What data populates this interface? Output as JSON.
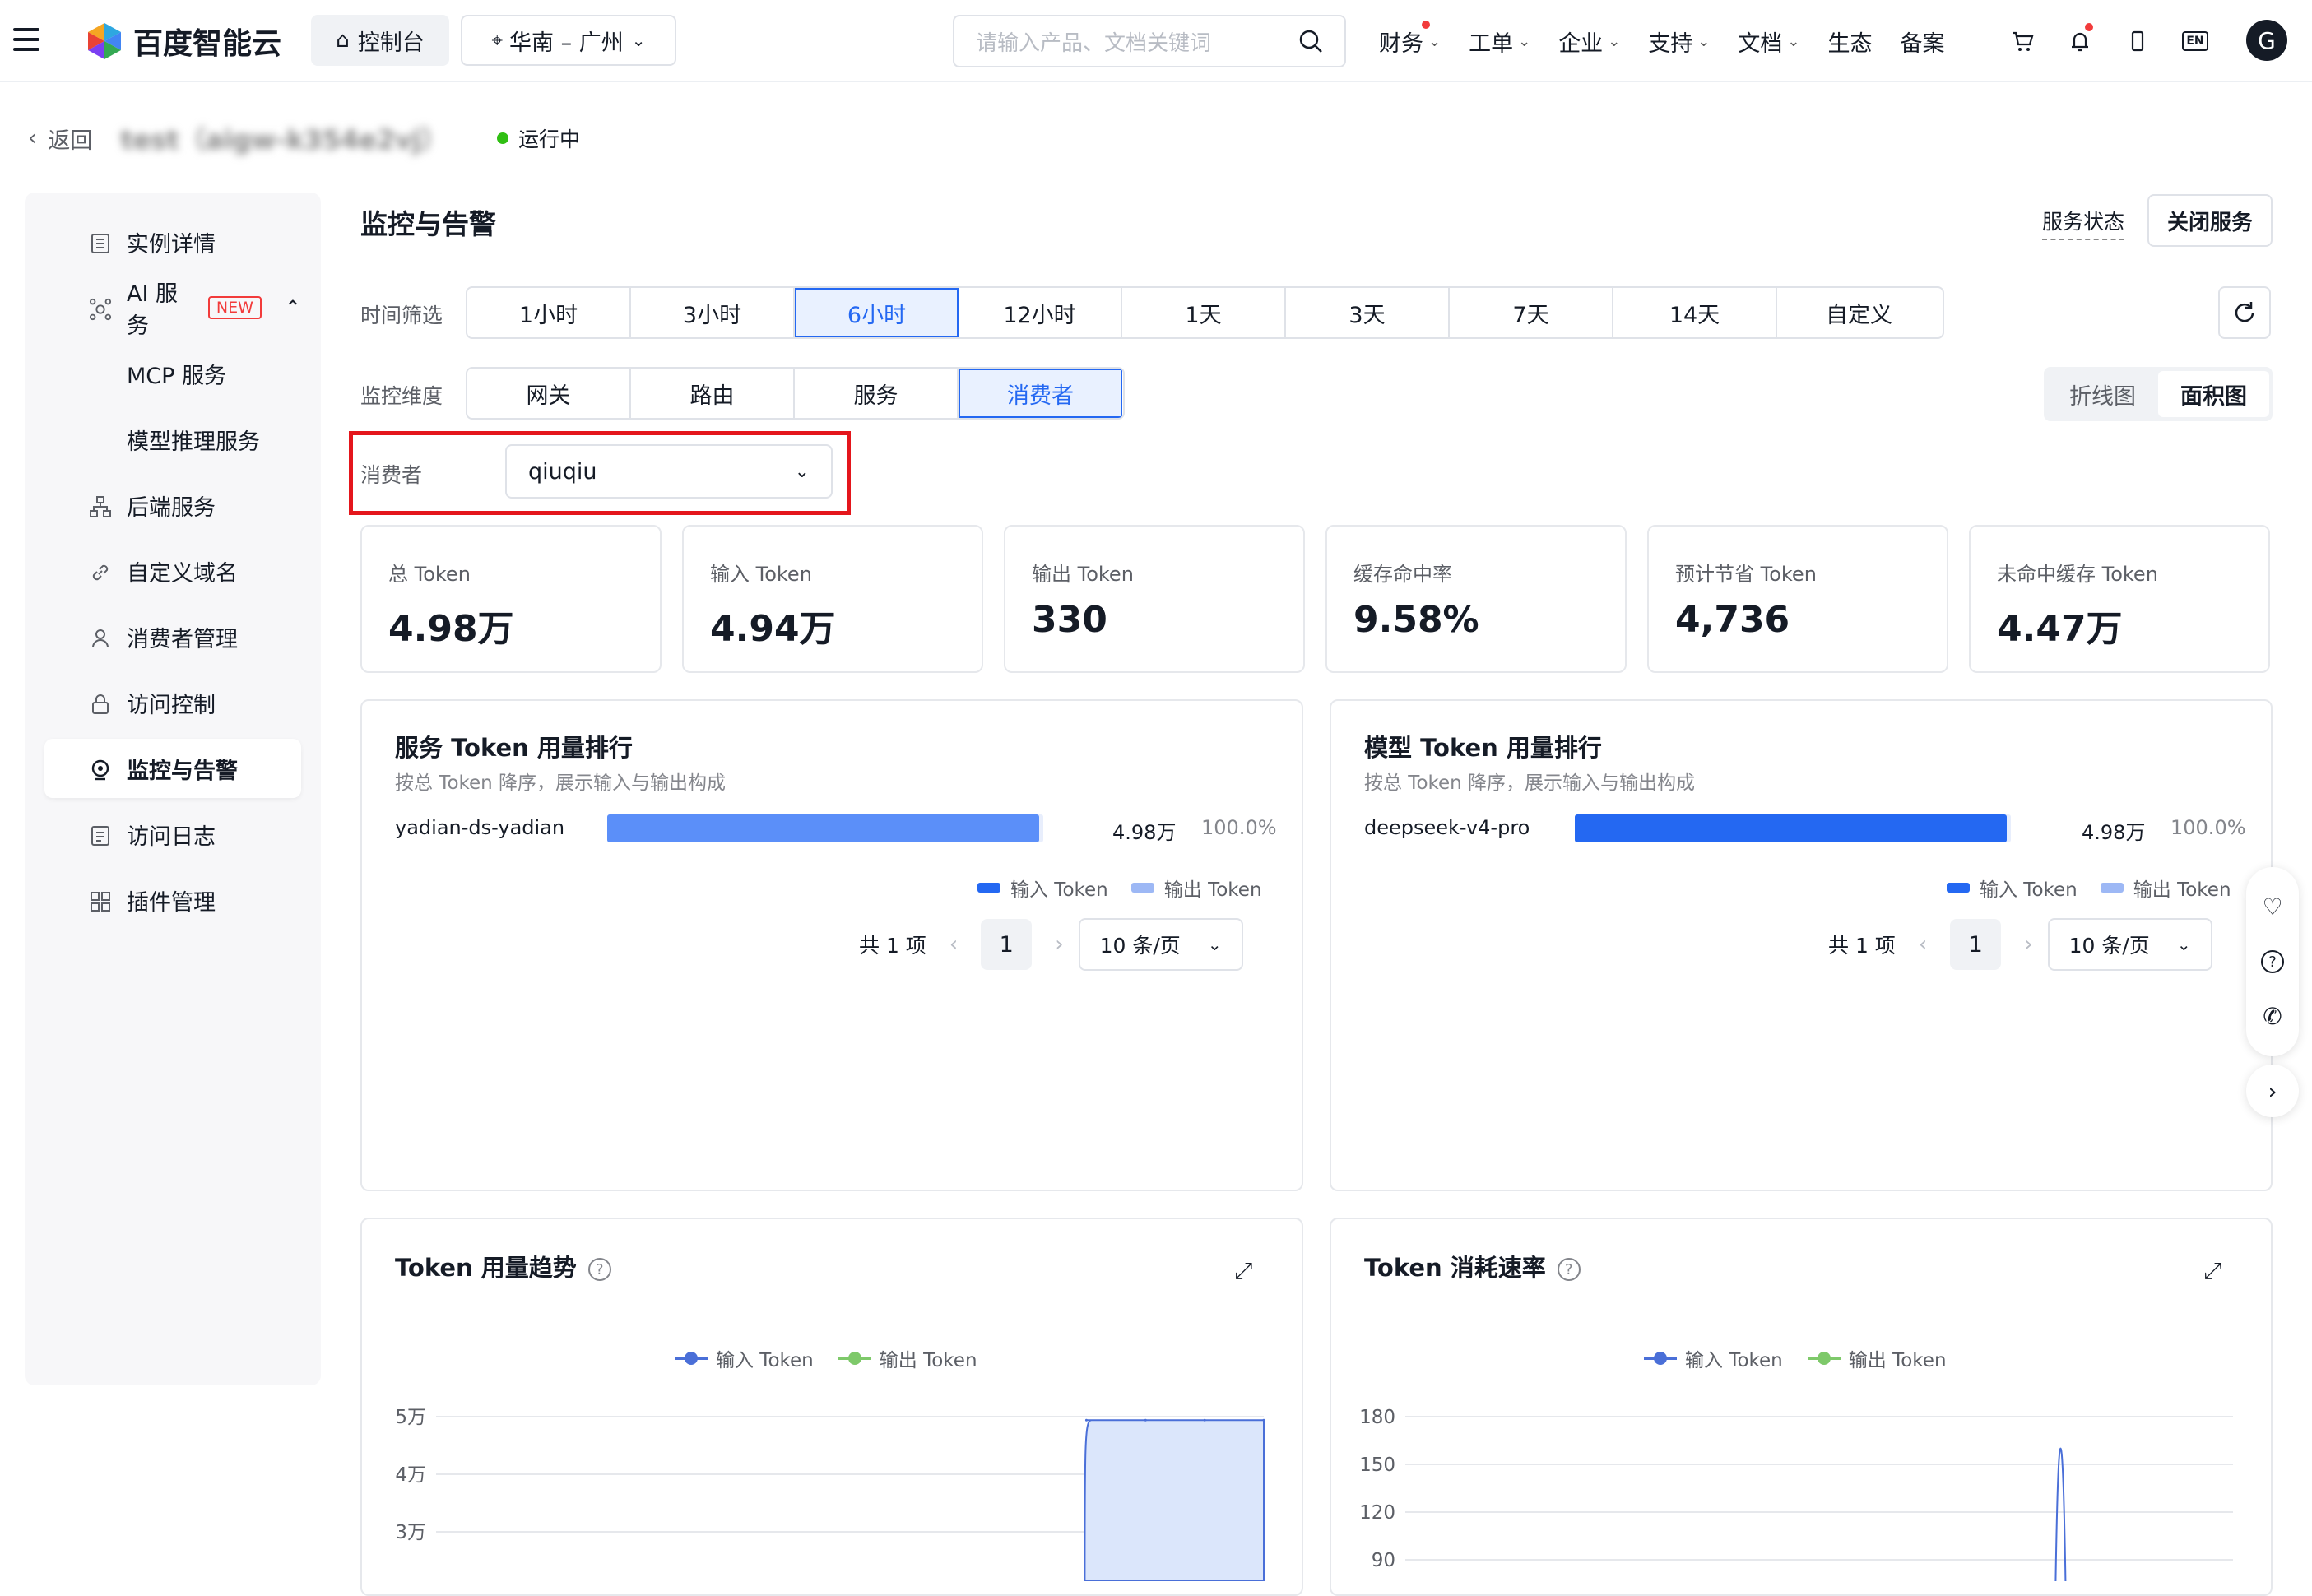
{
  "topbar": {
    "logo_text": "百度智能云",
    "console_label": "控制台",
    "region_label": "华南 – 广州",
    "search_placeholder": "请输入产品、文档关键词",
    "nav": [
      {
        "label": "财务",
        "dot": true
      },
      {
        "label": "工单"
      },
      {
        "label": "企业"
      },
      {
        "label": "支持"
      },
      {
        "label": "文档"
      },
      {
        "label": "生态"
      },
      {
        "label": "备案"
      }
    ],
    "avatar_letter": "G",
    "en_label": "EN"
  },
  "header": {
    "back_label": "返回",
    "instance_title": "test（aigw-k354e2vj）",
    "status_label": "运行中",
    "status_color": "#30bf13"
  },
  "sidebar": {
    "items": [
      {
        "label": "实例详情",
        "icon": "doc-list-icon"
      },
      {
        "label": "AI 服务",
        "icon": "ai-network-icon",
        "badge": "NEW"
      },
      {
        "label": "MCP 服务"
      },
      {
        "label": "模型推理服务"
      },
      {
        "label": "后端服务",
        "icon": "hierarchy-icon"
      },
      {
        "label": "自定义域名",
        "icon": "link-icon"
      },
      {
        "label": "消费者管理",
        "icon": "user-icon"
      },
      {
        "label": "访问控制",
        "icon": "lock-icon"
      },
      {
        "label": "监控与告警",
        "icon": "monitor-icon",
        "active": true
      },
      {
        "label": "访问日志",
        "icon": "log-icon"
      },
      {
        "label": "插件管理",
        "icon": "grid-icon"
      }
    ]
  },
  "main": {
    "title": "监控与告警",
    "service_status_label": "服务状态",
    "close_service_label": "关闭服务",
    "time_filter_label": "时间筛选",
    "time_options": [
      "1小时",
      "3小时",
      "6小时",
      "12小时",
      "1天",
      "3天",
      "7天",
      "14天",
      "自定义"
    ],
    "time_selected": "6小时",
    "dimension_label": "监控维度",
    "dimension_options": [
      "网关",
      "路由",
      "服务",
      "消费者"
    ],
    "dimension_selected": "消费者",
    "chart_types": [
      "折线图",
      "面积图"
    ],
    "chart_type_selected": "面积图",
    "consumer_label": "消费者",
    "consumer_value": "qiuqiu",
    "highlight_color": "#e4161c",
    "accent_color": "#2468f2"
  },
  "stats": [
    {
      "label": "总 Token",
      "value": "4.98万"
    },
    {
      "label": "输入 Token",
      "value": "4.94万"
    },
    {
      "label": "输出 Token",
      "value": "330"
    },
    {
      "label": "缓存命中率",
      "value": "9.58%"
    },
    {
      "label": "预计节省 Token",
      "value": "4,736"
    },
    {
      "label": "未命中缓存 Token",
      "value": "4.47万"
    }
  ],
  "rank_cards": [
    {
      "title": "服务 Token 用量排行",
      "subtitle": "按总 Token 降序，展示输入与输出构成",
      "rows": [
        {
          "name": "yadian-ds-yadian",
          "value": "4.98万",
          "pct": "100.0%",
          "input_share": 0.99
        }
      ],
      "bar_color": "#5b8ff9",
      "legend": [
        "输入 Token",
        "输出 Token"
      ],
      "total_label": "共 1 项",
      "page": "1",
      "page_size": "10 条/页"
    },
    {
      "title": "模型 Token 用量排行",
      "subtitle": "按总 Token 降序，展示输入与输出构成",
      "rows": [
        {
          "name": "deepseek-v4-pro",
          "value": "4.98万",
          "pct": "100.0%",
          "input_share": 0.99
        }
      ],
      "bar_color": "#2468f2",
      "legend": [
        "输入 Token",
        "输出 Token"
      ],
      "total_label": "共 1 项",
      "page": "1",
      "page_size": "10 条/页"
    }
  ],
  "legend_colors": {
    "input": "#2468f2",
    "output": "#9db8f5",
    "line_input": "#4a6fd8",
    "line_output": "#7ec96a"
  },
  "chart_data": [
    {
      "type": "area",
      "title": "Token 用量趋势",
      "legend": [
        "输入 Token",
        "输出 Token"
      ],
      "y_tick_labels": [
        "5万",
        "4万",
        "3万"
      ],
      "y_ticks": [
        50000,
        40000,
        30000
      ],
      "ylim": [
        30000,
        50000
      ],
      "series": [
        {
          "name": "输入 Token",
          "values": [
            0,
            0,
            0,
            0,
            0,
            0,
            0,
            0,
            0,
            0,
            0,
            49400,
            49400,
            49400,
            49400
          ]
        },
        {
          "name": "输出 Token",
          "values": [
            0,
            0,
            0,
            0,
            0,
            0,
            0,
            0,
            0,
            0,
            0,
            330,
            330,
            330,
            330
          ]
        }
      ],
      "grid": true,
      "legend_position": "top-center"
    },
    {
      "type": "line",
      "title": "Token 消耗速率",
      "legend": [
        "输入 Token",
        "输出 Token"
      ],
      "y_ticks": [
        180,
        150,
        120,
        90
      ],
      "ylim": [
        90,
        180
      ],
      "series": [
        {
          "name": "输入 Token",
          "values": [
            0,
            0,
            0,
            0,
            0,
            0,
            0,
            0,
            0,
            0,
            0,
            0,
            0,
            0,
            0,
            0,
            0,
            0,
            0,
            160,
            0,
            0,
            0,
            0,
            0
          ]
        }
      ],
      "grid": true,
      "legend_position": "top-center"
    }
  ]
}
